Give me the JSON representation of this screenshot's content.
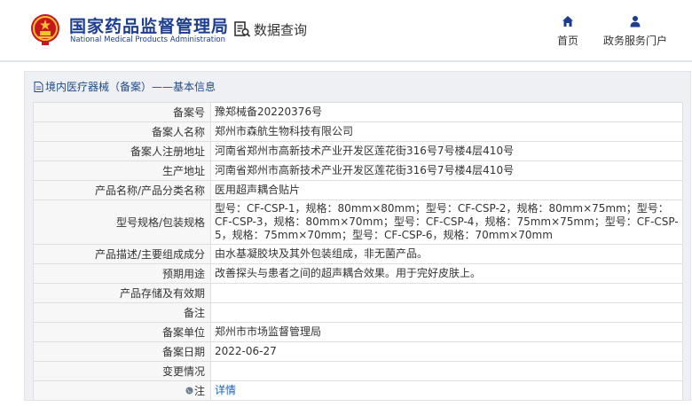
{
  "header": {
    "brand_cn": "国家药品监督管理局",
    "brand_en": "National Medical Products Administration",
    "query_label": "数据查询",
    "nav": [
      {
        "label": "首页",
        "icon": "home-icon"
      },
      {
        "label": "政务服务门户",
        "icon": "user-icon"
      }
    ]
  },
  "panel": {
    "title": "境内医疗器械（备案）——基本信息"
  },
  "rows": [
    {
      "key": "备案号",
      "value": "豫郑械备20220376号"
    },
    {
      "key": "备案人名称",
      "value": "郑州市森航生物科技有限公司"
    },
    {
      "key": "备案人注册地址",
      "value": "河南省郑州市高新技术产业开发区莲花街316号7号楼4层410号"
    },
    {
      "key": "生产地址",
      "value": "河南省郑州市高新技术产业开发区莲花街316号7号楼4层410号"
    },
    {
      "key": "产品名称/产品分类名称",
      "value": "医用超声耦合贴片"
    },
    {
      "key": "型号规格/包装规格",
      "value": "型号：CF-CSP-1，规格：80mm×80mm；型号：CF-CSP-2，规格：80mm×75mm；型号：CF-CSP-3，规格：80mm×70mm；型号：CF-CSP-4，规格：75mm×75mm；型号：CF-CSP-5，规格：75mm×70mm；型号：CF-CSP-6，规格：70mm×70mm"
    },
    {
      "key": "产品描述/主要组成成分",
      "value": "由水基凝胶块及其外包装组成，非无菌产品。"
    },
    {
      "key": "预期用途",
      "value": "改善探头与患者之间的超声耦合效果。用于完好皮肤上。"
    },
    {
      "key": "产品存储及有效期",
      "value": ""
    },
    {
      "key": "备注",
      "value": ""
    },
    {
      "key": "备案单位",
      "value": "郑州市市场监督管理局"
    },
    {
      "key": "备案日期",
      "value": "2022-06-27"
    },
    {
      "key": "变更情况",
      "value": ""
    },
    {
      "key": "注",
      "value": "详情"
    }
  ],
  "colors": {
    "brand": "#1d3d8f",
    "link": "#1f5fbf",
    "panel_bg": "#eef0f3"
  }
}
